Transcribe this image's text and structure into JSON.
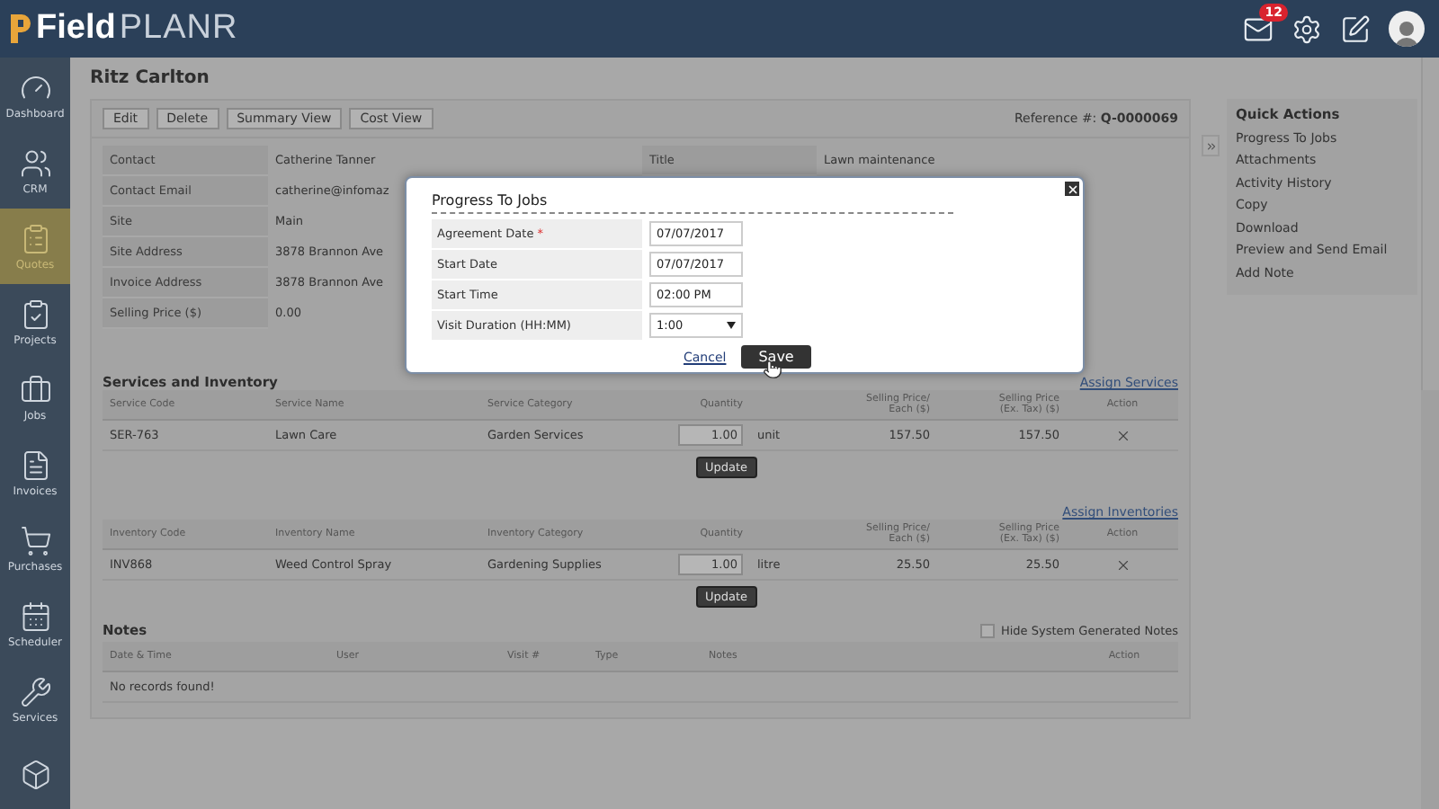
{
  "header": {
    "logo_left": "Field",
    "logo_right": "PLANR",
    "mail_badge": "12"
  },
  "sidebar": [
    {
      "label": "Dashboard",
      "selected": false
    },
    {
      "label": "CRM",
      "selected": false
    },
    {
      "label": "Quotes",
      "selected": true
    },
    {
      "label": "Projects",
      "selected": false
    },
    {
      "label": "Jobs",
      "selected": false
    },
    {
      "label": "Invoices",
      "selected": false
    },
    {
      "label": "Purchases",
      "selected": false
    },
    {
      "label": "Scheduler",
      "selected": false
    },
    {
      "label": "Services",
      "selected": false
    },
    {
      "selected": false
    }
  ],
  "page": {
    "title": "Ritz Carlton",
    "toolbar": [
      "Edit",
      "Delete",
      "Summary View",
      "Cost View"
    ],
    "reference_label": "Reference #:",
    "reference": "Q-0000069"
  },
  "details": [
    {
      "label": "Contact",
      "value": "Catherine Tanner",
      "right_label": "Title",
      "right_value": "Lawn maintenance"
    },
    {
      "label": "Contact Email",
      "value": "catherine@infomaz"
    },
    {
      "label": "Site",
      "value": "Main"
    },
    {
      "label": "Site Address",
      "value": "3878 Brannon Ave"
    },
    {
      "label": "Invoice Address",
      "value": "3878 Brannon Ave"
    },
    {
      "label": "Selling Price ($)",
      "value": "0.00"
    }
  ],
  "services": {
    "title": "Services and Inventory",
    "link": "Assign Services",
    "columns": [
      "Service Code",
      "Service Name",
      "Service Category",
      "Quantity",
      "",
      "Selling Price/\nEach ($)",
      "Selling Price\n(Ex. Tax) ($)",
      "Action"
    ],
    "rows": [
      {
        "code": "SER-763",
        "name": "Lawn Care",
        "category": "Garden Services",
        "quantity": "1.00",
        "unit": "unit",
        "price": "157.50",
        "total": "157.50"
      }
    ],
    "update": "Update"
  },
  "inventory": {
    "link": "Assign Inventories",
    "columns": [
      "Inventory Code",
      "Inventory Name",
      "Inventory Category",
      "Quantity",
      "",
      "Selling Price/\nEach ($)",
      "Selling Price\n(Ex. Tax) ($)",
      "Action"
    ],
    "rows": [
      {
        "code": "INV868",
        "name": "Weed Control Spray",
        "category": "Gardening Supplies",
        "quantity": "1.00",
        "unit": "litre",
        "price": "25.50",
        "total": "25.50"
      }
    ],
    "update": "Update"
  },
  "notes": {
    "title": "Notes",
    "hide_system": {
      "label": "Hide System Generated Notes",
      "checked": false
    },
    "columns": [
      "Date & Time",
      "User",
      "Visit #",
      "Type",
      "Notes",
      "Action"
    ],
    "empty": "No records found!"
  },
  "quick_actions": {
    "title": "Quick Actions",
    "items": [
      "Progress To Jobs",
      "Attachments",
      "Activity History",
      "Copy",
      "Download",
      "Preview and Send Email",
      "Add Note"
    ]
  },
  "modal": {
    "title": "Progress To Jobs",
    "required_mark": "*",
    "fields": [
      {
        "label": "Agreement Date",
        "required": true,
        "kind": "text",
        "value": "07/07/2017"
      },
      {
        "label": "Start Date",
        "required": false,
        "kind": "text",
        "value": "07/07/2017"
      },
      {
        "label": "Start Time",
        "required": false,
        "kind": "text",
        "value": "02:00 PM"
      },
      {
        "label": "Visit Duration (HH:MM)",
        "required": false,
        "kind": "select",
        "value": "1:00"
      }
    ],
    "cancel": "Cancel",
    "save": "Save"
  }
}
